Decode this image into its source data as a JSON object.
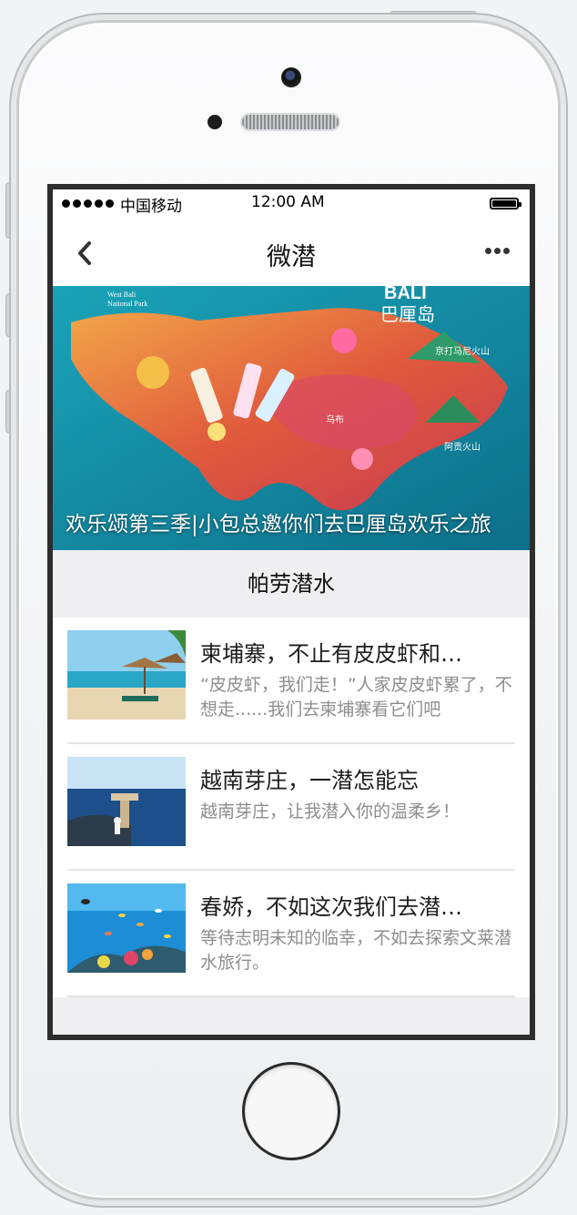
{
  "status_bar": {
    "carrier": "中国移动",
    "time": "12:00 AM"
  },
  "nav": {
    "title": "微潜"
  },
  "banner": {
    "caption": "欢乐颂第三季|小包总邀你们去巴厘岛欢乐之旅",
    "map_text": {
      "bali": "BALI",
      "bali_cn": "巴厘岛",
      "west_bali": "West Bali\nNational Park",
      "kintamani": "京打马尼火山",
      "amed": "阿贡火山",
      "ubud": "乌布"
    }
  },
  "section": {
    "title": "帕劳潜水"
  },
  "articles": [
    {
      "title": "柬埔寨，不止有皮皮虾和…",
      "summary": "“皮皮虾，我们走！”人家皮皮虾累了，不想走......我们去柬埔寨看它们吧",
      "thumb": "beach-umbrellas"
    },
    {
      "title": "越南芽庄，一潜怎能忘",
      "summary": "越南芽庄，让我潜入你的温柔乡！",
      "thumb": "pier-sea"
    },
    {
      "title": "春娇，不如这次我们去潜…",
      "summary": "等待志明未知的临幸，不如去探索文莱潜水旅行。",
      "thumb": "reef-fish"
    }
  ],
  "colors": {
    "background": "#efeff1",
    "text_primary": "#1d1d1d",
    "text_secondary": "#8d8d8d"
  }
}
